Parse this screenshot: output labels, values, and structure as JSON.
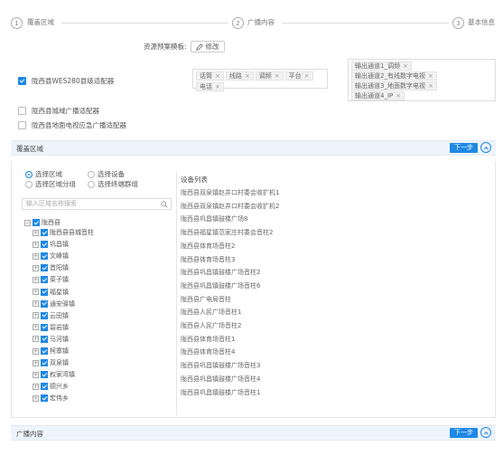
{
  "steps": [
    {
      "num": "1",
      "label": "覆盖区域"
    },
    {
      "num": "2",
      "label": "广播内容"
    },
    {
      "num": "3",
      "label": "基本信息"
    }
  ],
  "template": {
    "label": "资源预案模板:",
    "edit_label": "修改"
  },
  "adapters": [
    {
      "label": "陇西县WES280县级适配器",
      "checked": true
    },
    {
      "label": "陇西县城域广播适配器",
      "checked": false
    },
    {
      "label": "陇西县地面电视应急广播适配器",
      "checked": false
    }
  ],
  "input_tags": [
    "话筒",
    "线路",
    "调频",
    "平台",
    "电话"
  ],
  "output_tags": [
    "输出通道1_调频",
    "输出通道2_有线数字电视",
    "输出通道3_地面数字电视",
    "输出通道4_IP"
  ],
  "coverage_section": {
    "title": "覆盖区域",
    "next_label": "下一步"
  },
  "broadcast_section": {
    "title": "广播内容",
    "next_label": "下一步"
  },
  "radios": {
    "select_area": "选择区域",
    "select_device": "选择设备",
    "select_area_group": "选择区域分组",
    "select_terminal_group": "选择终端群组"
  },
  "search": {
    "placeholder": "输入区域名称搜索"
  },
  "tree": {
    "root": "陇西县",
    "children": [
      "陇西县县城音柱",
      "巩昌镇",
      "文峰镇",
      "首阳镇",
      "菜子镇",
      "福星镇",
      "通安驿镇",
      "云田镇",
      "碧岩镇",
      "马河镇",
      "柯寨镇",
      "双泉镇",
      "权家湾镇",
      "德兴乡",
      "宏伟乡"
    ]
  },
  "device_list": {
    "header": "设备列表",
    "items": [
      "陇西县双泉镇赵井口村委会收扩机1",
      "陇西县双泉镇赵井口村委会收扩机2",
      "陇西县巩昌镇鼓楼广场8",
      "陇西县福星镇范家庄村委会音柱2",
      "陇西县体育场音柱2",
      "陇西县体育场音柱3",
      "陇西县巩昌镇鼓楼广场音柱2",
      "陇西县巩昌镇鼓楼广场音柱6",
      "陇西县广电局音柱",
      "陇西县人民广场音柱1",
      "陇西县人民广场音柱2",
      "陇西县体育场音柱1",
      "陇西县体育场音柱4",
      "陇西县巩昌镇鼓楼广场音柱3",
      "陇西县巩昌镇鼓楼广场音柱4",
      "陇西县巩昌镇鼓楼广场音柱1"
    ]
  },
  "colors": {
    "accent": "#1e88e5",
    "section_bg": "#edf4fb"
  }
}
